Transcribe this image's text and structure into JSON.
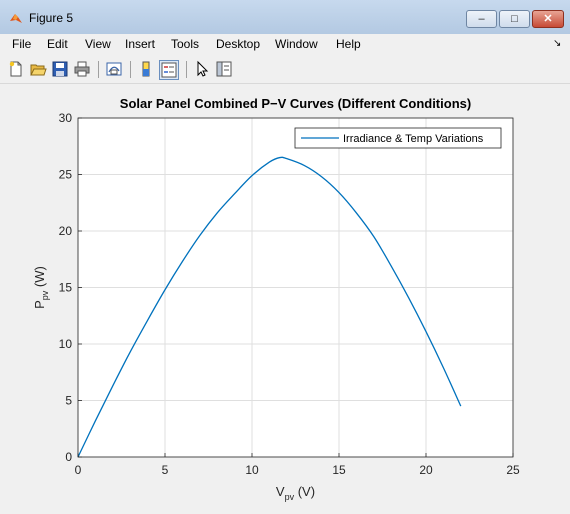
{
  "window": {
    "title": "Figure 5",
    "minimize_label": "–",
    "maximize_label": "□",
    "close_label": "✕"
  },
  "menu": {
    "items": [
      "File",
      "Edit",
      "View",
      "Insert",
      "Tools",
      "Desktop",
      "Window",
      "Help"
    ],
    "dock_glyph": "↘"
  },
  "toolbar": {
    "icons": [
      "new-figure-icon",
      "open-file-icon",
      "save-icon",
      "print-icon",
      "link-plot-icon",
      "colorbar-icon",
      "legend-icon",
      "pointer-icon",
      "property-editor-icon"
    ]
  },
  "chart_data": {
    "type": "line",
    "title": "Solar Panel Combined P−V Curves (Different Conditions)",
    "xlabel": "V",
    "xlabel_sub": "pv",
    "xlabel_unit": " (V)",
    "ylabel": "P",
    "ylabel_sub": "pv",
    "ylabel_unit": " (W)",
    "xlim": [
      0,
      25
    ],
    "ylim": [
      0,
      30
    ],
    "xticks": [
      0,
      5,
      10,
      15,
      20,
      25
    ],
    "yticks": [
      0,
      5,
      10,
      15,
      20,
      25,
      30
    ],
    "grid": true,
    "legend_position": "top-right",
    "series": [
      {
        "name": "Irradiance & Temp Variations",
        "color": "#0072bd",
        "x": [
          0,
          1,
          2,
          3,
          4,
          5,
          6,
          7,
          8,
          9,
          10,
          11,
          11.6,
          12,
          13,
          14,
          15,
          16,
          17,
          18,
          19,
          20,
          21,
          22
        ],
        "y": [
          0,
          3.2,
          6.3,
          9.3,
          12.1,
          14.8,
          17.3,
          19.6,
          21.6,
          23.3,
          24.9,
          26.1,
          26.5,
          26.4,
          25.8,
          24.8,
          23.4,
          21.6,
          19.5,
          16.9,
          14.1,
          11.1,
          7.9,
          4.5
        ]
      }
    ]
  }
}
